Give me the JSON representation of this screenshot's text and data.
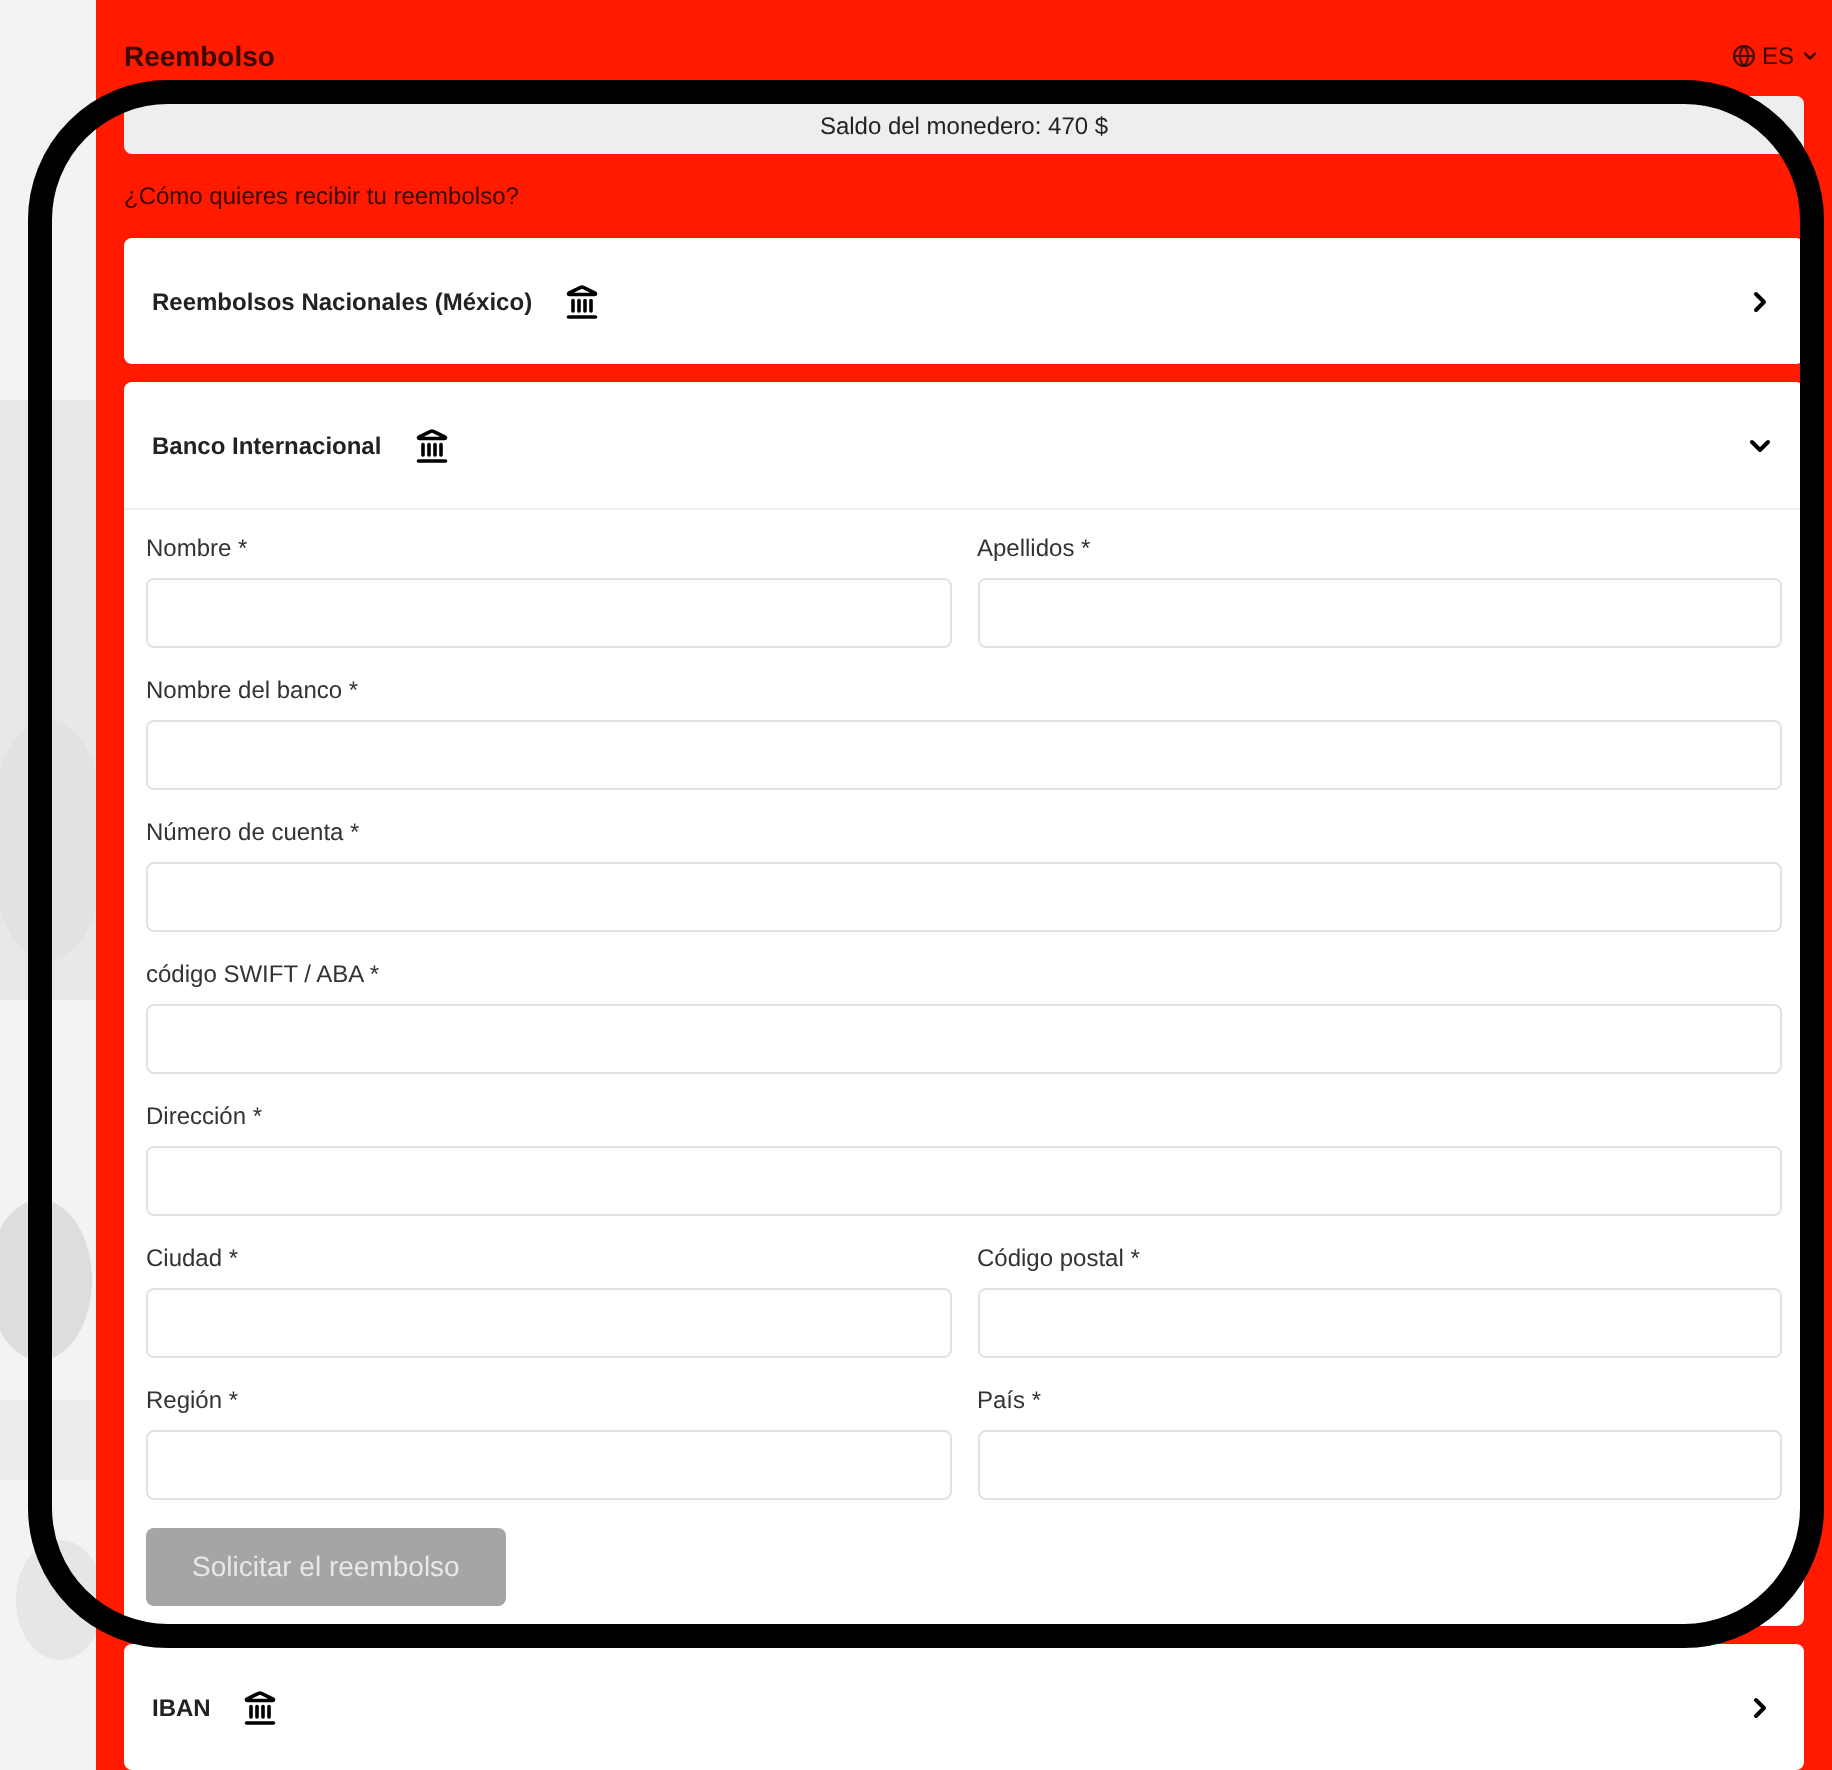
{
  "header": {
    "title": "Reembolso",
    "language": "ES"
  },
  "wallet_balance": "Saldo del monedero: 470 $",
  "question": "¿Cómo quieres recibir tu reembolso?",
  "methods": [
    {
      "label": "Reembolsos Nacionales (México)",
      "expanded": false
    },
    {
      "label": "Banco Internacional",
      "expanded": true,
      "form_rows": [
        [
          {
            "label": "Nombre *"
          },
          {
            "label": "Apellidos *"
          }
        ],
        [
          {
            "label": "Nombre del banco *"
          }
        ],
        [
          {
            "label": "Número de cuenta *"
          }
        ],
        [
          {
            "label": "código SWIFT / ABA *"
          }
        ],
        [
          {
            "label": "Dirección *"
          }
        ],
        [
          {
            "label": "Ciudad *"
          },
          {
            "label": "Código postal *"
          }
        ],
        [
          {
            "label": "Región *"
          },
          {
            "label": "País *"
          }
        ]
      ],
      "submit": {
        "label": "Solicitar el reembolso",
        "disabled": true
      }
    },
    {
      "label": "IBAN",
      "expanded": false
    }
  ]
}
